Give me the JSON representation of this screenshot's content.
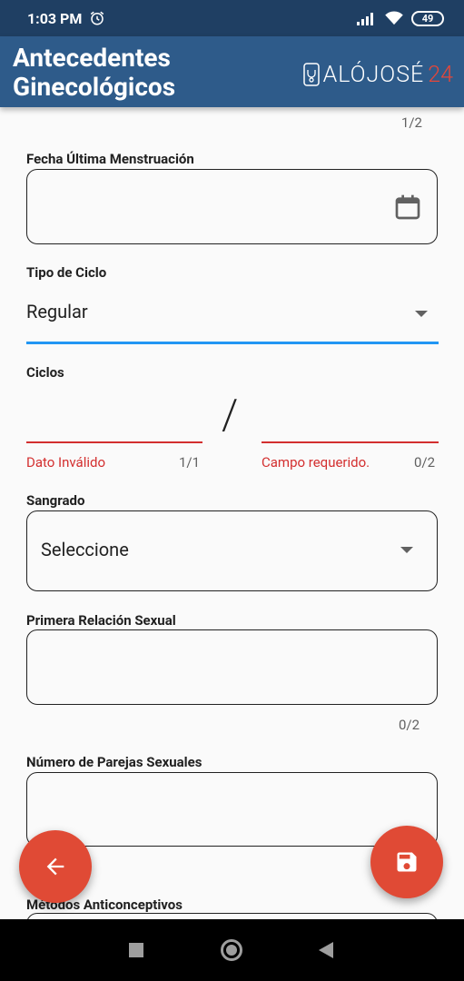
{
  "status_bar": {
    "time": "1:03 PM",
    "battery": "49"
  },
  "app_bar": {
    "title": "Antecedentes Ginecológicos",
    "logo_text": "ALÓJOSÉ",
    "logo_number": "24"
  },
  "form": {
    "page_counter": "1/2",
    "fecha": {
      "label": "Fecha Última Menstruación",
      "value": ""
    },
    "tipo_ciclo": {
      "label": "Tipo de Ciclo",
      "value": "Regular"
    },
    "ciclos": {
      "label": "Ciclos",
      "separator": "/",
      "left_error": "Dato Inválido",
      "left_counter": "1/1",
      "right_error": "Campo requerido.",
      "right_counter": "0/2"
    },
    "sangrado": {
      "label": "Sangrado",
      "value": "Seleccione"
    },
    "primera_relacion": {
      "label": "Primera Relación Sexual",
      "counter": "0/2",
      "value": ""
    },
    "parejas": {
      "label": "Número de Parejas Sexuales",
      "value": ""
    },
    "metodos": {
      "label": "Métodos Anticonceptivos"
    }
  },
  "colors": {
    "app_bar": "#2e5b8a",
    "status_bar": "#1f3f63",
    "fab": "#e04a35",
    "error": "#d32f2f",
    "focus": "#2196f3"
  },
  "icons": [
    "alarm-icon",
    "signal-icon",
    "wifi-icon",
    "calendar-icon",
    "arrow-back-icon",
    "save-icon"
  ]
}
